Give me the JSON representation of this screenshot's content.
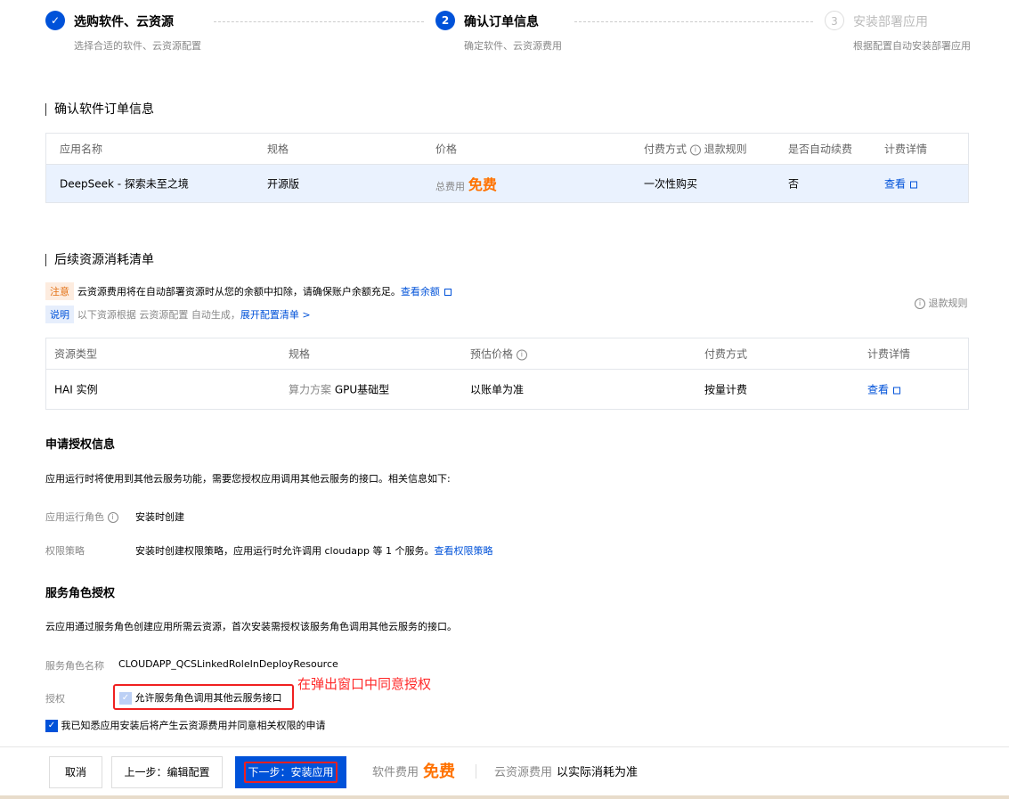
{
  "steps": [
    {
      "num": "✓",
      "title": "选购软件、云资源",
      "sub": "选择合适的软件、云资源配置",
      "state": "done"
    },
    {
      "num": "2",
      "title": "确认订单信息",
      "sub": "确定软件、云资源费用",
      "state": "current"
    },
    {
      "num": "3",
      "title": "安装部署应用",
      "sub": "根据配置自动安装部署应用",
      "state": "todo"
    }
  ],
  "order": {
    "title": "确认软件订单信息",
    "headers": [
      "应用名称",
      "规格",
      "价格",
      "付费方式",
      "退款规则",
      "是否自动续费",
      "计费详情"
    ],
    "row": {
      "name": "DeepSeek - 探索未至之境",
      "spec": "开源版",
      "price_label": "总费用",
      "price": "免费",
      "pay": "一次性购买",
      "renew": "否",
      "detail": "查看"
    }
  },
  "resources": {
    "title": "后续资源消耗清单",
    "notice_tag": "注意",
    "notice_text": "云资源费用将在自动部署资源时从您的余额中扣除，请确保账户余额充足。",
    "notice_link": "查看余额",
    "explain_tag": "说明",
    "explain_text": "以下资源根据 云资源配置 自动生成，",
    "explain_link": "展开配置清单 >",
    "refund": "退款规则",
    "headers": [
      "资源类型",
      "规格",
      "预估价格",
      "付费方式",
      "计费详情"
    ],
    "row": {
      "type": "HAI 实例",
      "spec_label": "算力方案",
      "spec": "GPU基础型",
      "price": "以账单为准",
      "pay": "按量计费",
      "detail": "查看"
    }
  },
  "auth": {
    "title": "申请授权信息",
    "desc": "应用运行时将使用到其他云服务功能，需要您授权应用调用其他云服务的接口。相关信息如下:",
    "role_label": "应用运行角色",
    "role_value": "安装时创建",
    "policy_label": "权限策略",
    "policy_value": "安装时创建权限策略，应用运行时允许调用 cloudapp 等 1 个服务。",
    "policy_link": "查看权限策略"
  },
  "service": {
    "title": "服务角色授权",
    "desc": "云应用通过服务角色创建应用所需云资源，首次安装需授权该服务角色调用其他云服务的接口。",
    "name_label": "服务角色名称",
    "name_value": "CLOUDAPP_QCSLinkedRoleInDeployResource",
    "auth_label": "授权",
    "auth_check": "允许服务角色调用其他云服务接口",
    "annotation": "在弹出窗口中同意授权",
    "agree": "我已知悉应用安装后将产生云资源费用并同意相关权限的申请"
  },
  "footer": {
    "cancel": "取消",
    "prev": "上一步：编辑配置",
    "next": "下一步：安装应用",
    "soft_label": "软件费用",
    "soft_value": "免费",
    "cloud_label": "云资源费用",
    "cloud_value": "以实际消耗为准"
  },
  "colors": {
    "primary": "#0052d9",
    "orange": "#ff7200",
    "annotation": "#ff2a2a"
  }
}
